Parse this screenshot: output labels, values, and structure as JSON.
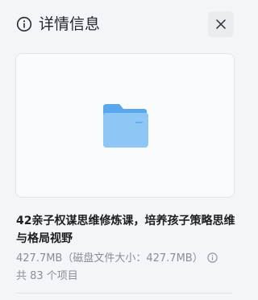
{
  "header": {
    "title": "详情信息",
    "info_icon": "info-circle-icon",
    "close_icon": "close-icon"
  },
  "preview": {
    "icon": "folder-icon",
    "colors": {
      "folder_front": "#8ec6f6",
      "folder_back": "#5aa7ee"
    }
  },
  "file": {
    "name": "42亲子权谋思维修炼课，培养孩子策略思维与格局视野",
    "size": "427.7MB（磁盘文件大小：427.7MB）",
    "item_count": "共 83 个项目",
    "size_hint_icon": "info-circle-icon"
  }
}
